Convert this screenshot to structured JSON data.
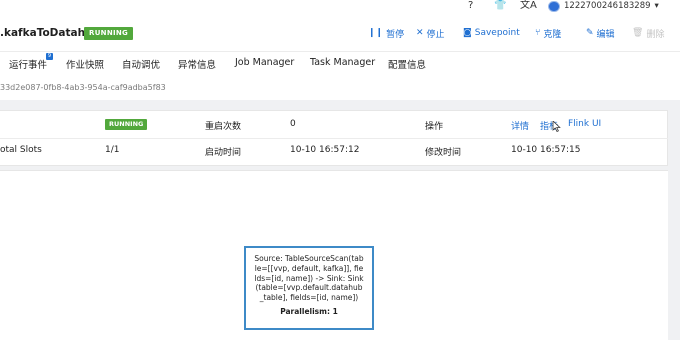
{
  "topbar": {
    "help_icon": "?",
    "shirt_icon": "👕",
    "translate_icon": "文A",
    "account_id": "1222700246183289",
    "dropdown_icon": "▾"
  },
  "header": {
    "title": ".kafkaToDatahub",
    "status": "RUNNING",
    "actions": {
      "pause": "暂停",
      "stop": "停止",
      "savepoint": "Savepoint",
      "clone": "克隆",
      "edit": "编辑",
      "delete": "删除"
    }
  },
  "tabs": [
    {
      "label": "运行事件",
      "badge": "9"
    },
    {
      "label": "作业快照"
    },
    {
      "label": "自动调优"
    },
    {
      "label": "异常信息"
    },
    {
      "label": "Job Manager"
    },
    {
      "label": "Task Manager"
    },
    {
      "label": "配置信息"
    }
  ],
  "job_id": "33d2e087-0fb8-4ab3-954a-caf9adba5f83",
  "summary": {
    "row1": {
      "status": "RUNNING",
      "restart_label": "重启次数",
      "restart_value": "0",
      "ops_label": "操作",
      "details": "详情",
      "metrics": "指标",
      "flink_ui": "Flink UI"
    },
    "row2": {
      "slots_label": "otal Slots",
      "slots_value": "1/1",
      "start_label": "启动时间",
      "start_value": "10-10 16:57:12",
      "modified_label": "修改时间",
      "modified_value": "10-10 16:57:15"
    }
  },
  "graph_node": {
    "description": "Source: TableSourceScan(table=[[vvp, default, kafka]], fields=[id, name]) -> Sink: Sink(table=[vvp.default.datahub_table], fields=[id, name])",
    "parallelism": "Parallelism: 1"
  },
  "colors": {
    "accent": "#1f6fd1",
    "running": "#52a83c",
    "node_border": "#3e8ac7"
  }
}
